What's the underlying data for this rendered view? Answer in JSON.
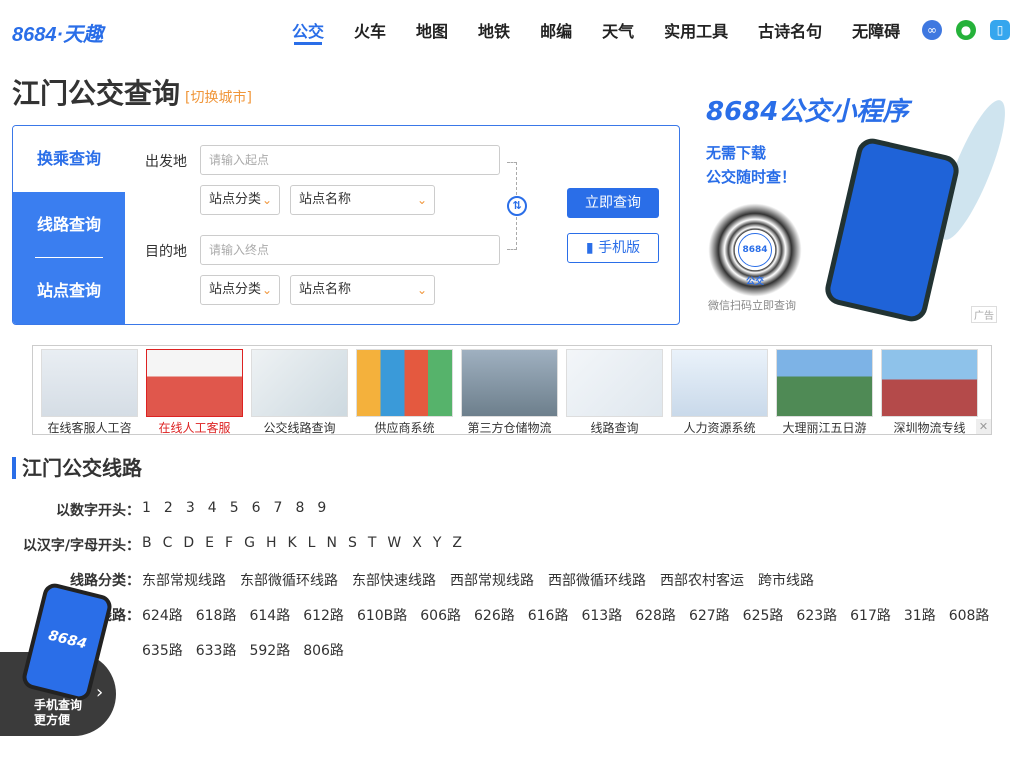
{
  "header": {
    "logo": "8684·天趣",
    "nav": [
      "公交",
      "火车",
      "地图",
      "地铁",
      "邮编",
      "天气",
      "实用工具",
      "古诗名句",
      "无障碍"
    ],
    "icons": [
      "mini-program-icon",
      "wechat-icon",
      "mobile-icon"
    ]
  },
  "page": {
    "title": "江门公交查询",
    "switch_city": "[切换城市]"
  },
  "query": {
    "tabs": [
      "换乘查询",
      "线路查询",
      "站点查询"
    ],
    "from_label": "出发地",
    "from_placeholder": "请输入起点",
    "to_label": "目的地",
    "to_placeholder": "请输入终点",
    "category_select": "站点分类",
    "name_select": "站点名称",
    "submit": "立即查询",
    "mobile": "手机版"
  },
  "ad_right": {
    "title": "8684公交小程序",
    "line1": "无需下载",
    "line2": "公交随时查！",
    "qr_center": "8684公交",
    "qr_caption": "微信扫码立即查询",
    "tag": "广告"
  },
  "banner": {
    "items": [
      "在线客服人工咨",
      "在线人工客服",
      "公交线路查询",
      "供应商系统",
      "第三方仓储物流",
      "线路查询",
      "人力资源系统",
      "大理丽江五日游",
      "深圳物流专线"
    ],
    "close": "✕"
  },
  "lines": {
    "title": "江门公交线路",
    "rows": [
      {
        "label": "以数字开头：",
        "items": [
          "1",
          "2",
          "3",
          "4",
          "5",
          "6",
          "7",
          "8",
          "9"
        ]
      },
      {
        "label": "以汉字/字母开头：",
        "items": [
          "B",
          "C",
          "D",
          "E",
          "F",
          "G",
          "H",
          "K",
          "L",
          "N",
          "S",
          "T",
          "W",
          "X",
          "Y",
          "Z"
        ]
      },
      {
        "label": "线路分类：",
        "items": [
          "东部常规线路",
          "东部微循环线路",
          "东部快速线路",
          "西部常规线路",
          "西部微循环线路",
          "西部农村客运",
          "跨市线路"
        ]
      },
      {
        "label": "热门线路：",
        "items": [
          "624路",
          "618路",
          "614路",
          "612路",
          "610B路",
          "606路",
          "626路",
          "616路",
          "613路",
          "628路",
          "627路",
          "625路",
          "623路",
          "617路",
          "31路",
          "608路"
        ]
      },
      {
        "label": "",
        "items": [
          "635路",
          "633路",
          "592路",
          "806路"
        ]
      }
    ]
  },
  "float_promo": {
    "line1": "手机查询",
    "line2": "更方便",
    "phone_text": "8684"
  }
}
